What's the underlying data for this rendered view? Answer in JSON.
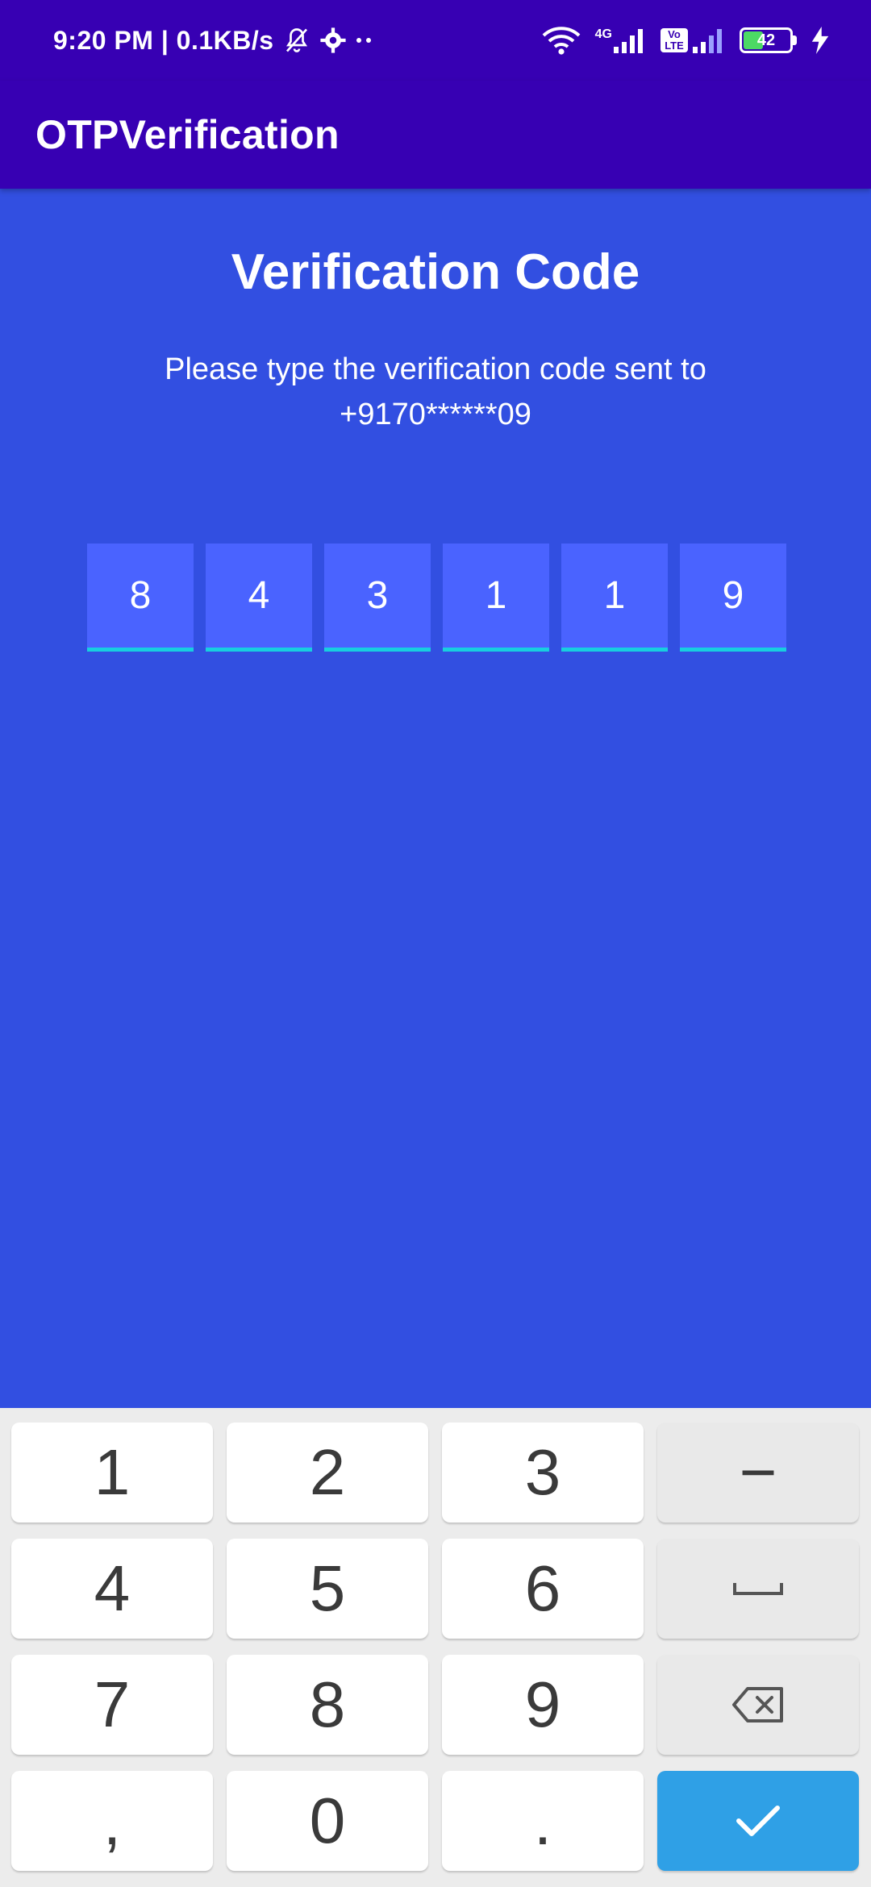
{
  "status_bar": {
    "time_speed": "9:20 PM | 0.1KB/s",
    "network_label": "4G",
    "volte_label": "Vo LTE",
    "battery_level": "42"
  },
  "app_bar": {
    "title": "OTPVerification"
  },
  "screen": {
    "heading": "Verification Code",
    "subtitle": "Please type the verification code sent to +9170******09"
  },
  "otp": {
    "digits": [
      "8",
      "4",
      "3",
      "1",
      "1",
      "9"
    ]
  },
  "keyboard": {
    "keys": [
      "1",
      "2",
      "3",
      "−",
      "4",
      "5",
      "6",
      "space",
      "7",
      "8",
      "9",
      "backspace",
      ",",
      "0",
      ".",
      "done"
    ],
    "labels": {
      "k1": "1",
      "k2": "2",
      "k3": "3",
      "dash": "−",
      "k4": "4",
      "k5": "5",
      "k6": "6",
      "k7": "7",
      "k8": "8",
      "k9": "9",
      "comma": ",",
      "k0": "0",
      "period": "."
    }
  },
  "colors": {
    "app_bar": "#3700b3",
    "background": "#324fe1",
    "otp_box": "#4a63ff",
    "otp_underline": "#17cfe0",
    "enter_key": "#2fa0e6"
  }
}
